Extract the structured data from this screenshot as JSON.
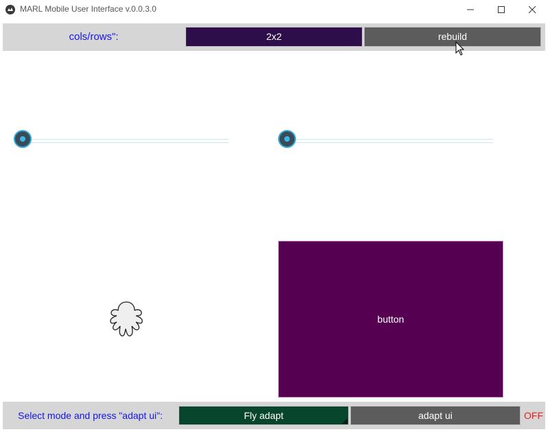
{
  "window": {
    "title": "MARL Mobile User Interface v.0.0.3.0",
    "icon": "kivy-logo-icon"
  },
  "top_bar": {
    "cols_label": "cols/rows\":",
    "grid_button": "2x2",
    "rebuild_button": "rebuild"
  },
  "sliders": [
    {
      "value": 0.0
    },
    {
      "value": 0.0
    }
  ],
  "image_widget": {
    "icon": "octocat-icon"
  },
  "main_button": {
    "label": "button"
  },
  "bottom_bar": {
    "mode_label": "Select mode and press \"adapt ui\":",
    "mode_button": "Fly adapt",
    "adapt_button": "adapt ui",
    "status": "OFF"
  },
  "colors": {
    "label_blue": "#1515e8",
    "grid_button": "#2e0e4a",
    "main_button": "#560052",
    "fly_button": "#07452d",
    "gray_button": "#5c5c5c",
    "status_red": "#e8201a",
    "slider_accent": "#31a9da"
  }
}
